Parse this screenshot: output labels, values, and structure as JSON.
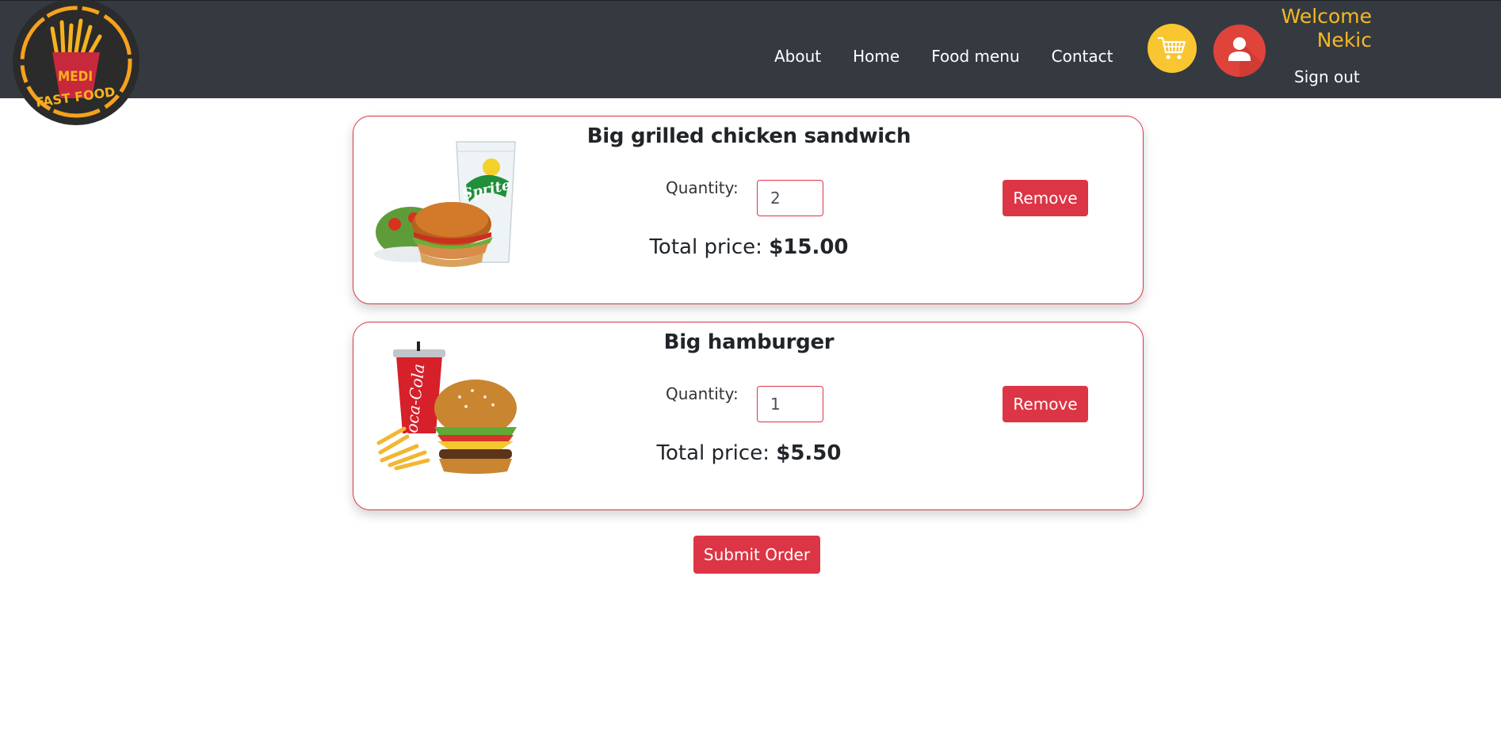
{
  "header": {
    "logo_text_line1": "MEDI",
    "logo_text_line2": "FAST FOOD",
    "nav": [
      {
        "label": "About"
      },
      {
        "label": "Home"
      },
      {
        "label": "Food menu"
      },
      {
        "label": "Contact"
      }
    ],
    "cart_icon": "shopping-cart-icon",
    "user_icon": "user-icon",
    "welcome_line1": "Welcome",
    "welcome_line2": "Nekic",
    "sign_out": "Sign out"
  },
  "cart": {
    "items": [
      {
        "name": "Big grilled chicken sandwich",
        "image": "chicken-sandwich-salad-sprite",
        "quantity_label": "Quantity:",
        "quantity": "2",
        "remove_label": "Remove",
        "total_label": "Total price:",
        "total_value": "$15.00"
      },
      {
        "name": "Big hamburger",
        "image": "hamburger-fries-coke",
        "quantity_label": "Quantity:",
        "quantity": "1",
        "remove_label": "Remove",
        "total_label": "Total price:",
        "total_value": "$5.50"
      }
    ],
    "submit_label": "Submit Order"
  },
  "colors": {
    "navbar": "#343a40",
    "accent_red": "#dc3545",
    "cart_yellow": "#f8c630",
    "welcome_text": "#f8b820"
  }
}
